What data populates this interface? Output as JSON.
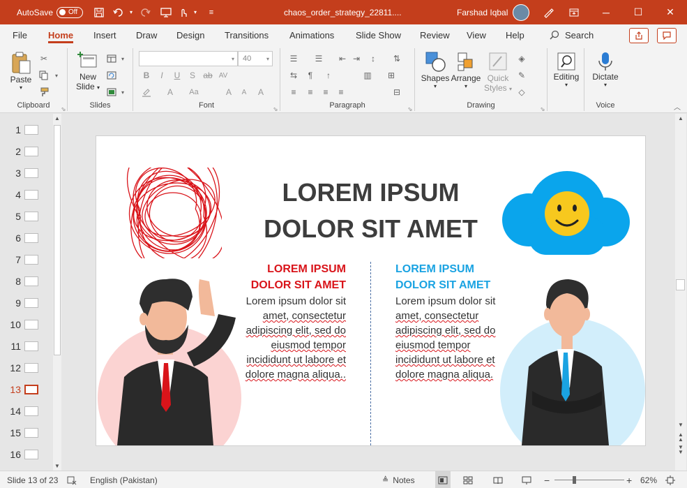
{
  "titlebar": {
    "autosave_label": "AutoSave",
    "autosave_state": "Off",
    "doc_title": "chaos_order_strategy_22811....",
    "user_name": "Farshad Iqbal",
    "accent": "#c43e1c"
  },
  "tabs": [
    "File",
    "Home",
    "Insert",
    "Draw",
    "Design",
    "Transitions",
    "Animations",
    "Slide Show",
    "Review",
    "View",
    "Help"
  ],
  "active_tab": "Home",
  "search_label": "Search",
  "ribbon": {
    "clipboard": {
      "label": "Clipboard",
      "paste": "Paste"
    },
    "slides": {
      "label": "Slides",
      "new_slide_1": "New",
      "new_slide_2": "Slide"
    },
    "font": {
      "label": "Font",
      "font_name": "",
      "font_size": "40"
    },
    "paragraph": {
      "label": "Paragraph"
    },
    "drawing": {
      "label": "Drawing",
      "shapes": "Shapes",
      "arrange": "Arrange",
      "quick_styles_1": "Quick",
      "quick_styles_2": "Styles"
    },
    "editing": {
      "label": "Editing"
    },
    "voice": {
      "label": "Voice",
      "dictate": "Dictate"
    }
  },
  "thumbnails": [
    "1",
    "2",
    "3",
    "4",
    "5",
    "6",
    "7",
    "8",
    "9",
    "10",
    "11",
    "12",
    "13",
    "14",
    "15",
    "16"
  ],
  "active_slide": "13",
  "slide": {
    "title_line1": "LOREM IPSUM",
    "title_line2": "DOLOR SIT AMET",
    "left_heading_1": "LOREM IPSUM",
    "left_heading_2": "DOLOR SIT AMET",
    "left_body": [
      "Lorem ipsum dolor sit",
      "amet, consectetur",
      "adipiscing elit, sed do",
      "eiusmod tempor",
      "incididunt ut labore et",
      "dolore magna aliqua.."
    ],
    "right_heading_1": "LOREM IPSUM",
    "right_heading_2": "DOLOR SIT AMET",
    "right_body": [
      "Lorem ipsum dolor sit",
      "amet, consectetur",
      "adipiscing elit, sed do",
      "eiusmod tempor",
      "incididunt ut labore et",
      "dolore magna aliqua."
    ],
    "red": "#d9141a",
    "blue": "#1aa3e2"
  },
  "statusbar": {
    "slide_info": "Slide 13 of 23",
    "language": "English (Pakistan)",
    "notes": "Notes",
    "zoom": "62%"
  }
}
